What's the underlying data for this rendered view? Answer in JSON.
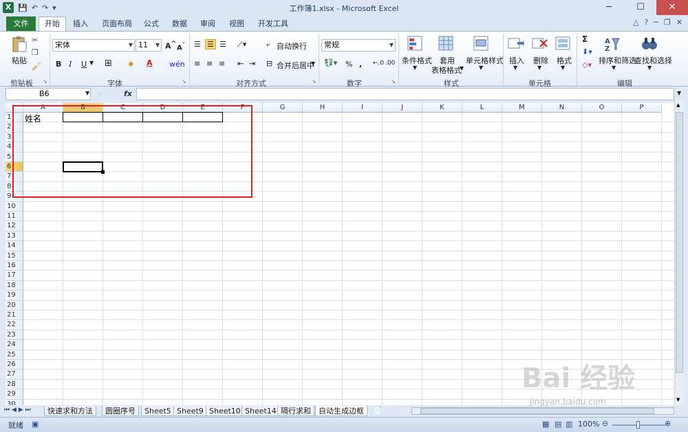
{
  "window": {
    "title": "工作簿1.xlsx - Microsoft Excel",
    "logo": "X"
  },
  "tabs": [
    "文件",
    "开始",
    "插入",
    "页面布局",
    "公式",
    "数据",
    "审阅",
    "视图",
    "开发工具"
  ],
  "ribbon": {
    "clipboard": {
      "label": "剪贴板",
      "paste": "粘贴"
    },
    "font": {
      "label": "字体",
      "name": "宋体",
      "size": "11",
      "bold": "B",
      "italic": "I",
      "underline": "U",
      "font_color_glyph": "A",
      "wen": "wén"
    },
    "alignment": {
      "label": "对齐方式",
      "wrap": "自动换行",
      "merge": "合并后居中"
    },
    "number": {
      "label": "数字",
      "format": "常规",
      "percent": "%",
      "comma": ","
    },
    "styles": {
      "label": "样式",
      "conditional": "条件格式",
      "table_line1": "套用",
      "table_line2": "表格格式",
      "cell_styles": "单元格样式"
    },
    "cells": {
      "label": "单元格",
      "insert": "插入",
      "delete": "删除",
      "format": "格式"
    },
    "editing": {
      "label": "编辑",
      "sigma": "Σ",
      "sort": "排序和筛选",
      "find": "查找和选择"
    }
  },
  "formula": {
    "namebox": "B6",
    "fx": "fx",
    "value": ""
  },
  "columns": [
    "A",
    "B",
    "C",
    "D",
    "E",
    "F",
    "G",
    "H",
    "I",
    "J",
    "K",
    "L",
    "M",
    "N",
    "O",
    "P"
  ],
  "rows": [
    "1",
    "2",
    "3",
    "4",
    "5",
    "6",
    "7",
    "8",
    "9",
    "10",
    "11",
    "12",
    "13",
    "14",
    "15",
    "16",
    "17",
    "18",
    "19",
    "20",
    "21",
    "22",
    "23",
    "24",
    "25",
    "26",
    "27",
    "28",
    "29",
    "30"
  ],
  "cells": {
    "A1": "姓名"
  },
  "selected": {
    "col": "B",
    "row": "6"
  },
  "sheet_tabs": [
    "快速求和方法",
    "圆圈序号",
    "Sheet5",
    "Sheet9",
    "Sheet10",
    "Sheet14",
    "隔行求和",
    "自动生成边框"
  ],
  "active_sheet": "自动生成边框",
  "status": {
    "ready": "就绪",
    "zoom": "100%"
  },
  "watermark": {
    "main": "Bai 经验",
    "sub": "jingyan.baidu.com"
  },
  "colors": {
    "file_tab": "#2a7a3b",
    "selected_header": "#f1c15f",
    "annotation": "#e02020"
  }
}
